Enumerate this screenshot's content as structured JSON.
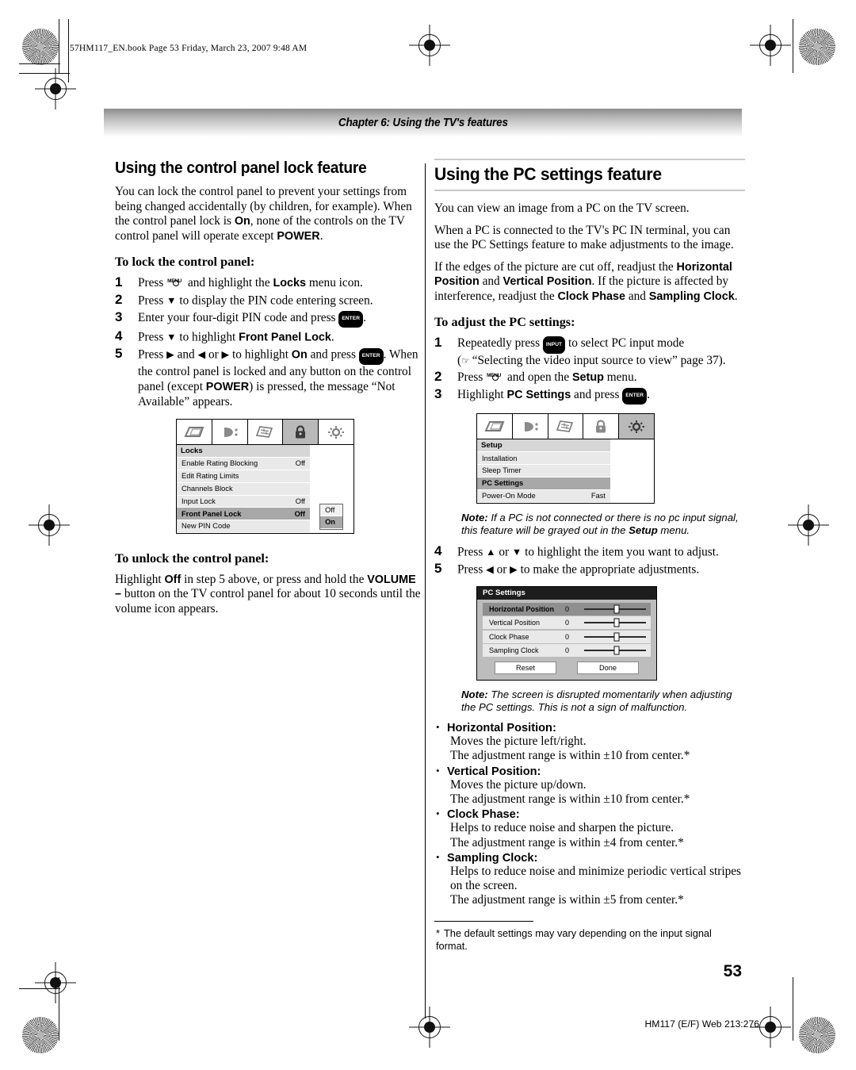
{
  "slug": "57HM117_EN.book  Page 53  Friday, March 23, 2007  9:48 AM",
  "chapter_banner": "Chapter 6: Using the TV's features",
  "page_number": "53",
  "footer": "HM117 (E/F) Web 213:276",
  "left": {
    "heading": "Using the control panel lock feature",
    "intro": {
      "p1a": "You can lock the control panel to prevent your settings from being changed accidentally (by children, for example). When the control panel lock is ",
      "b1": "On",
      "p1b": ", none of the controls on the TV control panel will operate except ",
      "b2": "POWER",
      "p1c": "."
    },
    "lock_subhead": "To lock the control panel:",
    "steps": [
      {
        "num": "1",
        "a": "Press ",
        "key": "MENU",
        "b": " and highlight the ",
        "bold": "Locks",
        "c": " menu icon."
      },
      {
        "num": "2",
        "a": "Press ",
        "arrow": "▼",
        "b": " to display the PIN code entering screen."
      },
      {
        "num": "3",
        "a": "Enter your four-digit PIN code and press ",
        "key": "ENTER",
        "b": "."
      },
      {
        "num": "4",
        "a": "Press ",
        "arrow": "▼",
        "b": " to highlight ",
        "bold": "Front Panel Lock",
        "c": "."
      },
      {
        "num": "5",
        "a": "Press ",
        "arrow1": "▶",
        "b": " and ",
        "arrow2": "◀",
        "c": " or ",
        "arrow3": "▶",
        "d": " to highlight ",
        "bold": "On",
        "e": " and press ",
        "key": "ENTER",
        "f": ". When the control panel is locked and any button on the control panel (except ",
        "bold2": "POWER",
        "g": ") is pressed, the message “Not Available” appears."
      }
    ],
    "osd_locks": {
      "icons": [
        "picture-icon",
        "audio-icon",
        "preferences-icon",
        "locks-icon",
        "setup-icon"
      ],
      "selected_icon_index": 3,
      "title": "Locks",
      "rows": [
        {
          "label": "Enable Rating Blocking",
          "value": "Off",
          "selected": false
        },
        {
          "label": "Edit Rating Limits",
          "value": "",
          "selected": false
        },
        {
          "label": "Channels Block",
          "value": "",
          "selected": false
        },
        {
          "label": "Input Lock",
          "value": "Off",
          "selected": false
        },
        {
          "label": "Front Panel Lock",
          "value": "Off",
          "selected": true
        },
        {
          "label": "New PIN Code",
          "value": "",
          "selected": false
        }
      ],
      "popup": [
        {
          "label": "Off",
          "selected": false
        },
        {
          "label": "On",
          "selected": true
        }
      ]
    },
    "unlock_subhead": "To unlock the control panel:",
    "unlock_text": {
      "a": "Highlight ",
      "b1": "Off",
      "b": " in step 5 above, or press and hold the ",
      "b2": "VOLUME –",
      "c": " button on the TV control panel for about 10 seconds until the volume icon appears."
    }
  },
  "right": {
    "heading": "Using the PC settings feature",
    "p1": "You can view an image from a PC on the TV screen.",
    "p2": "When a PC is connected to the TV's PC IN terminal, you can use the PC Settings feature to make adjustments to the image.",
    "p3": {
      "a": "If the edges of the picture are cut off, readjust the ",
      "b1": "Horizontal Position",
      "b": " and ",
      "b2": "Vertical Position",
      "c": ". If the picture is affected by interference, readjust the ",
      "b3": "Clock Phase",
      "d": " and ",
      "b4": "Sampling Clock",
      "e": "."
    },
    "adjust_subhead": "To adjust the PC settings:",
    "steps": [
      {
        "num": "1",
        "a": "Repeatedly press ",
        "key": "INPUT",
        "b": " to select PC input mode",
        "line2_hand": "☞",
        "line2": " “Selecting the video input source to view” page 37).",
        "paren": "("
      },
      {
        "num": "2",
        "a": "Press ",
        "key": "MENU",
        "b": " and open the ",
        "bold": "Setup",
        "c": " menu."
      },
      {
        "num": "3",
        "a": "Highlight ",
        "bold": "PC Settings",
        "b": " and press ",
        "key": "ENTER",
        "c": "."
      }
    ],
    "osd_setup": {
      "icons": [
        "picture-icon",
        "audio-icon",
        "preferences-icon",
        "locks-icon",
        "setup-icon"
      ],
      "selected_icon_index": 4,
      "title": "Setup",
      "rows": [
        {
          "label": "Installation",
          "value": "",
          "selected": false
        },
        {
          "label": "Sleep Timer",
          "value": "",
          "selected": false
        },
        {
          "label": "PC Settings",
          "value": "",
          "selected": true
        },
        {
          "label": "Power-On Mode",
          "value": "Fast",
          "selected": false
        }
      ]
    },
    "note1": {
      "label": "Note:",
      "a": " If a PC is not connected or there is no pc input signal, this feature will be grayed out in the ",
      "b": "Setup",
      "c": " menu."
    },
    "steps2": [
      {
        "num": "4",
        "a": "Press ",
        "arrow1": "▲",
        "b": " or ",
        "arrow2": "▼",
        "c": " to highlight the item you want to adjust."
      },
      {
        "num": "5",
        "a": "Press ",
        "arrow1": "◀",
        "b": " or ",
        "arrow2": "▶",
        "c": " to make the appropriate adjustments."
      }
    ],
    "pc_settings_panel": {
      "title": "PC Settings",
      "rows": [
        {
          "label": "Horizontal Position",
          "value": "0",
          "selected": true
        },
        {
          "label": "Vertical Position",
          "value": "0",
          "selected": false
        },
        {
          "label": "Clock Phase",
          "value": "0",
          "selected": false
        },
        {
          "label": "Sampling Clock",
          "value": "0",
          "selected": false
        }
      ],
      "reset_label": "Reset",
      "done_label": "Done"
    },
    "note2": {
      "label": "Note:",
      "a": " The screen is disrupted momentarily when adjusting the PC settings. This is not a sign of malfunction."
    },
    "bullets": [
      {
        "title": "Horizontal Position:",
        "lines": [
          "Moves the picture left/right.",
          "The adjustment range is within ±10 from center.*"
        ]
      },
      {
        "title": "Vertical Position:",
        "lines": [
          "Moves the picture up/down.",
          "The adjustment range is within ±10 from center.*"
        ]
      },
      {
        "title": "Clock Phase:",
        "lines": [
          "Helps to reduce noise and sharpen the picture.",
          "The adjustment range is within ±4 from center.*"
        ]
      },
      {
        "title": "Sampling Clock:",
        "lines": [
          "Helps to reduce noise and minimize periodic vertical stripes on the screen.",
          "The adjustment range is within ±5 from center.*"
        ]
      }
    ],
    "footnote": {
      "star": "*",
      "text": "The default settings may vary depending on the input signal format."
    }
  }
}
